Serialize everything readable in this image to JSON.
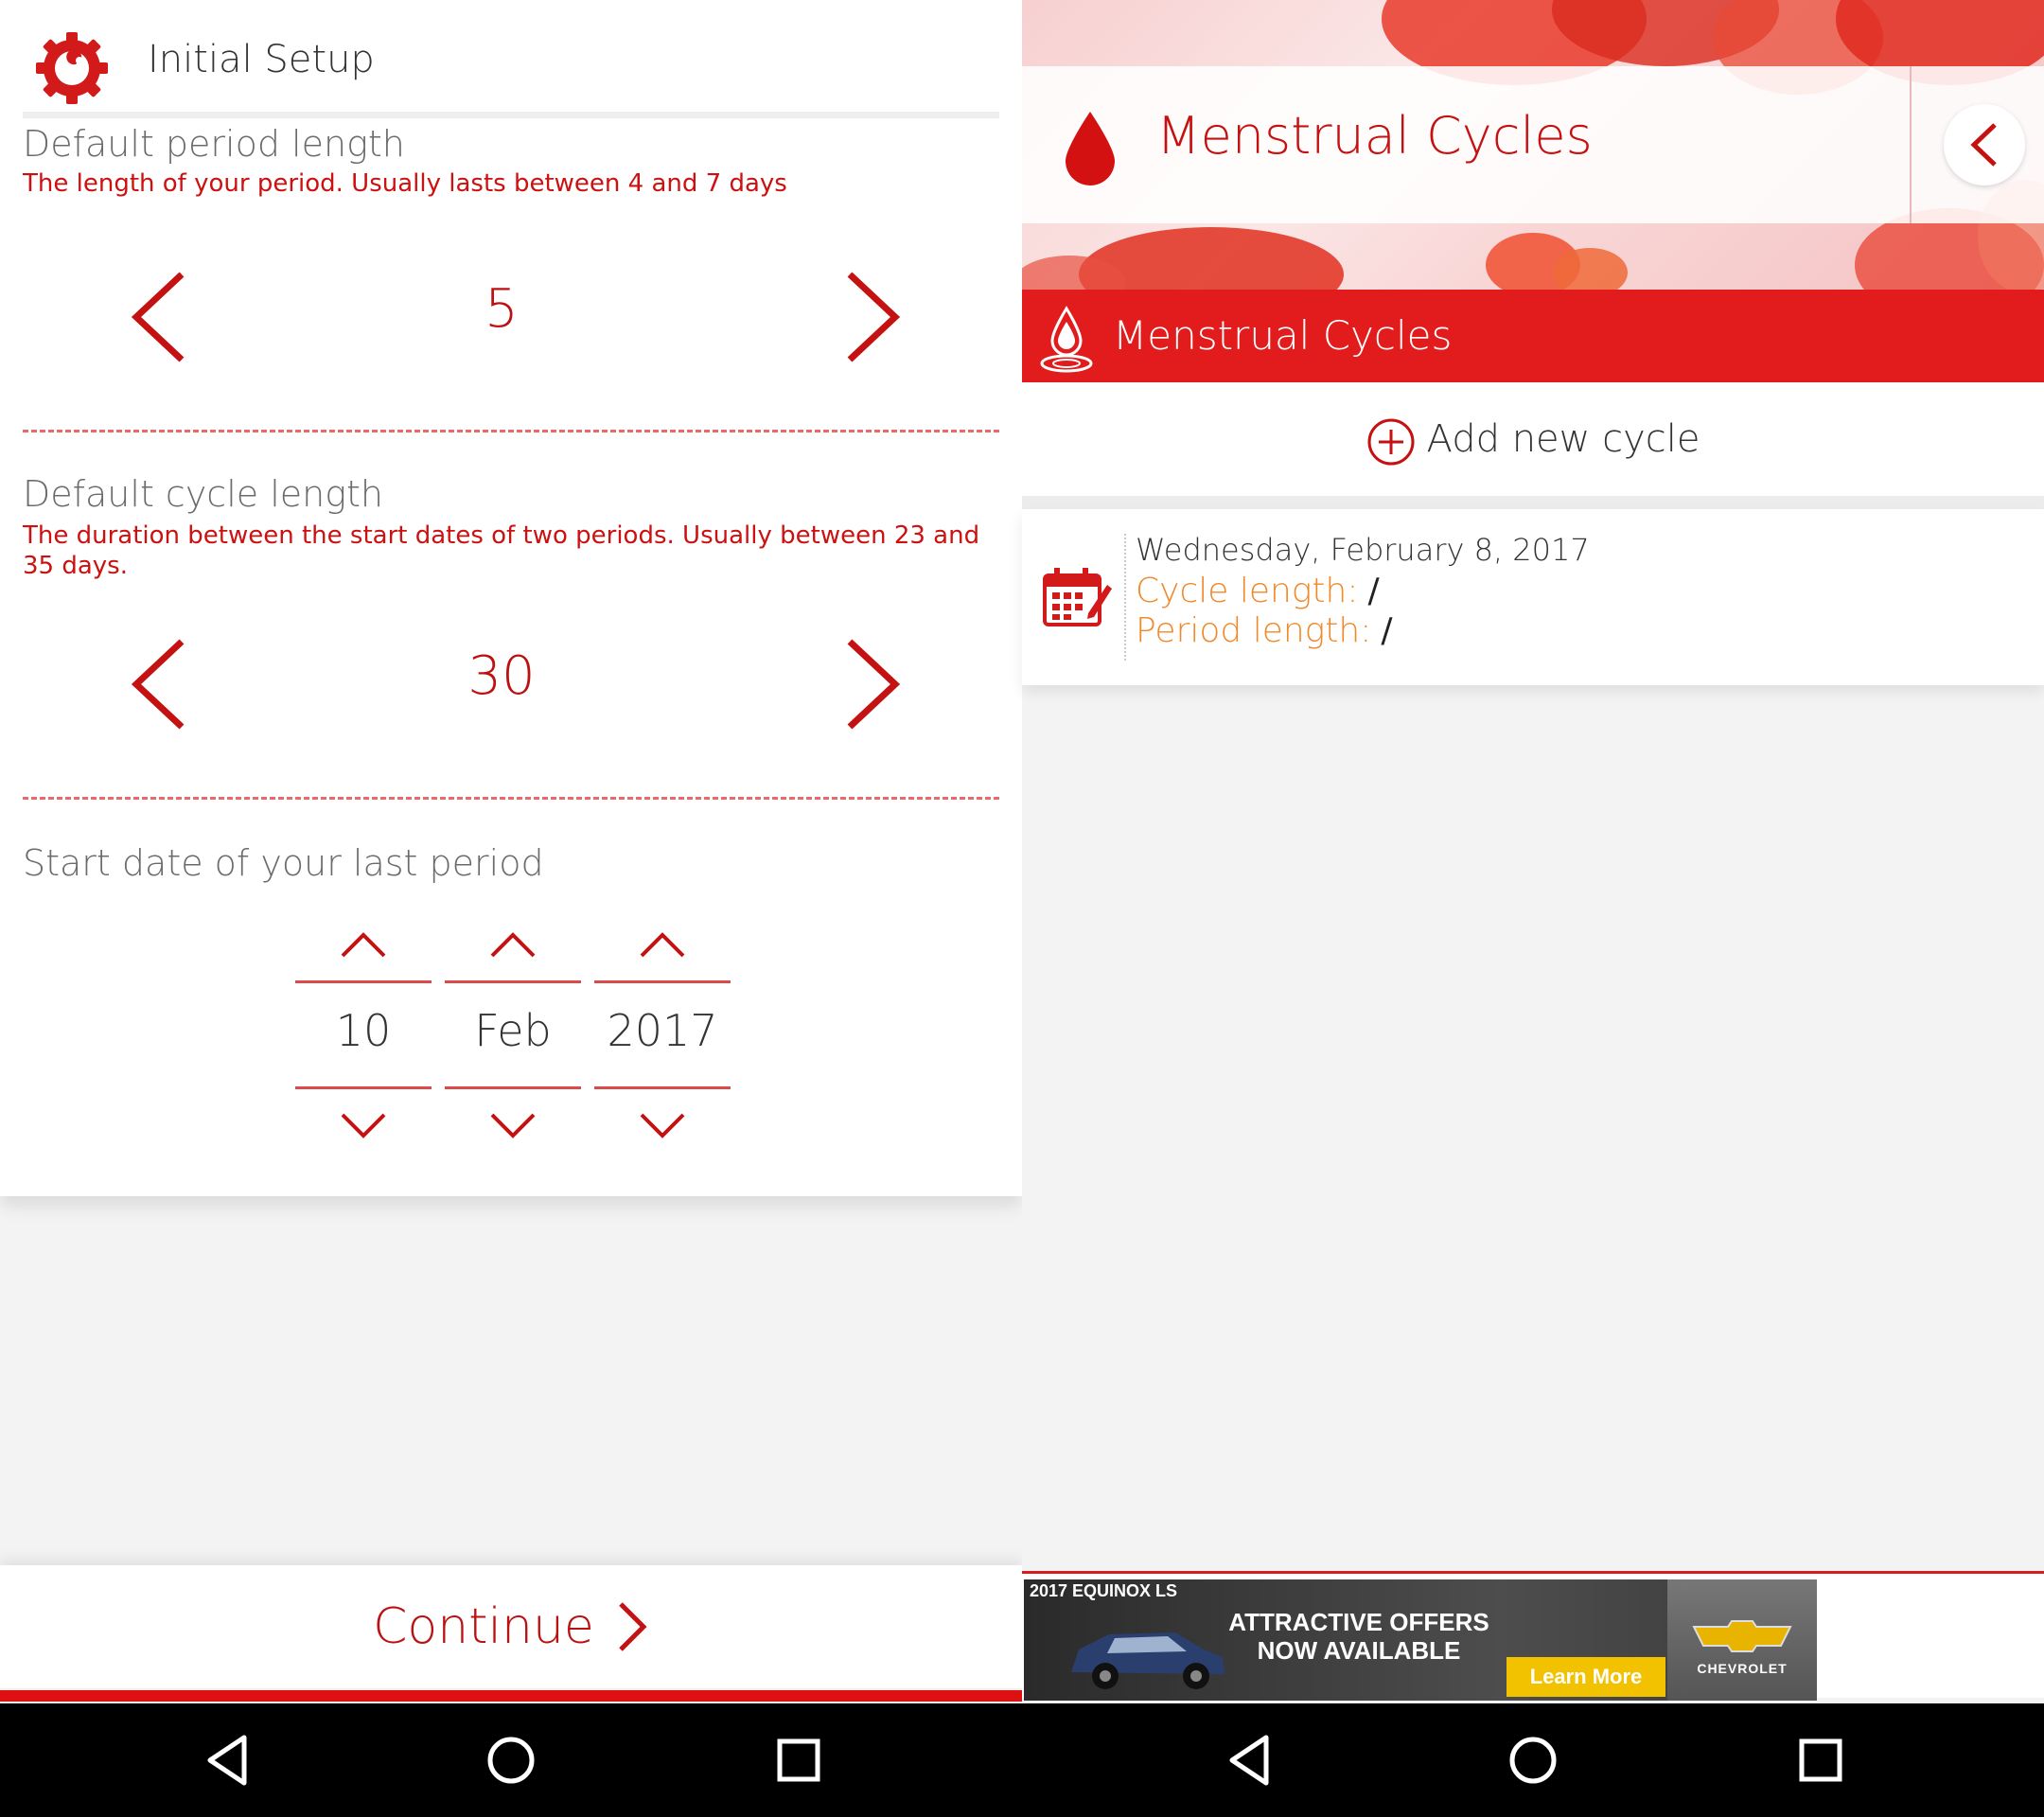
{
  "left": {
    "header": {
      "title": "Initial Setup",
      "icon": "gear-wrench-icon"
    },
    "period": {
      "title": "Default period length",
      "desc": "The length of your period. Usually lasts between 4 and 7 days",
      "value": "5"
    },
    "cycle": {
      "title": "Default cycle length",
      "desc": "The duration between the start dates of two periods. Usually between 23 and 35 days.",
      "value": "30"
    },
    "start": {
      "title": "Start date of your last period",
      "day": "10",
      "month": "Feb",
      "year": "2017"
    },
    "continue_label": "Continue"
  },
  "right": {
    "app_title": "Menstrual Cycles",
    "section_title": "Menstrual Cycles",
    "add_label": "Add new cycle",
    "cycle": {
      "date": "Wednesday, February 8, 2017",
      "cycle_label": "Cycle length:",
      "cycle_value": "/",
      "period_label": "Period length:",
      "period_value": "/"
    },
    "ad": {
      "model": "2017 EQUINOX LS",
      "offer_line1": "ATTRACTIVE OFFERS",
      "offer_line2": "NOW AVAILABLE",
      "cta": "Learn More",
      "brand": "CHEVROLET"
    }
  },
  "colors": {
    "accent": "#cc1111",
    "section": "#e21c1c",
    "orange": "#f0892a"
  },
  "nav": [
    "back-icon",
    "home-icon",
    "recents-icon"
  ]
}
